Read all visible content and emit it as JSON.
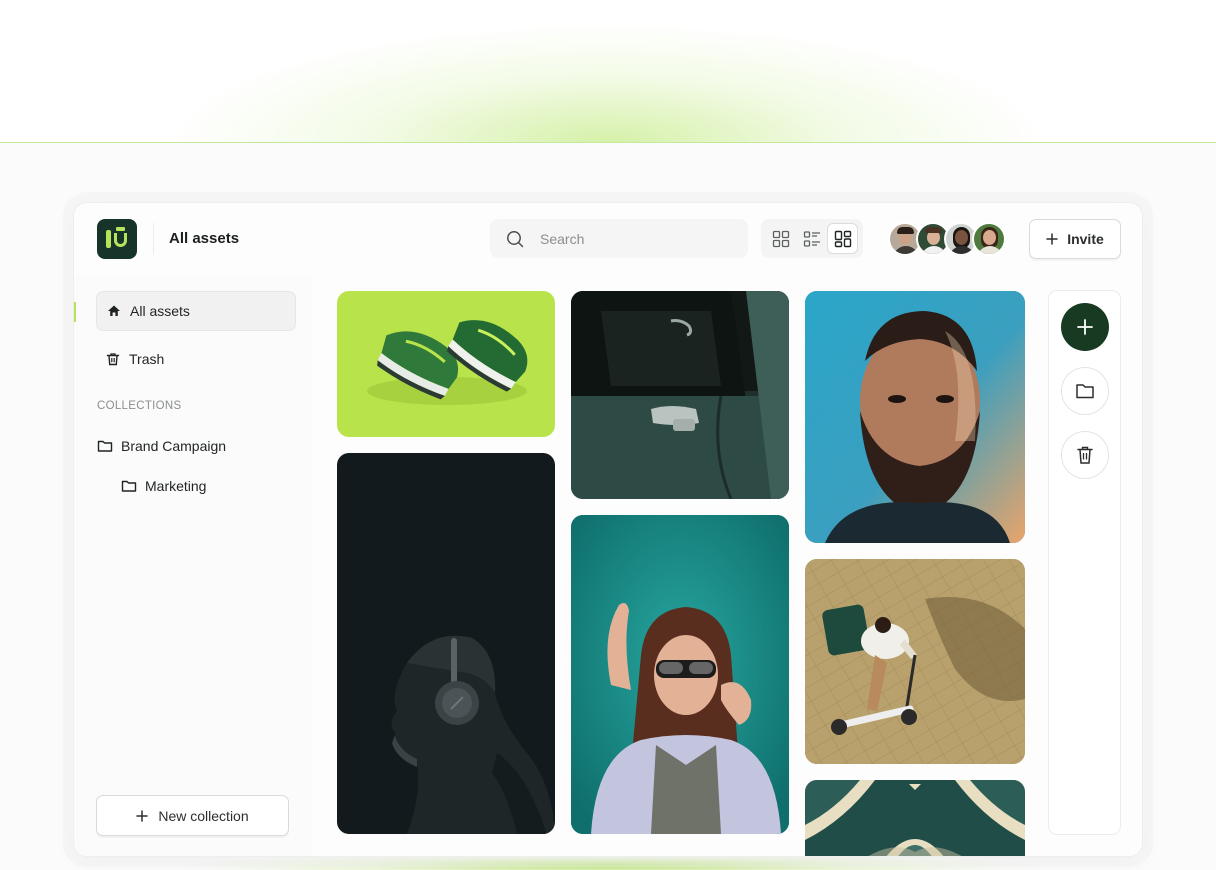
{
  "header": {
    "title": "All assets",
    "search_placeholder": "Search",
    "invite_label": "Invite",
    "view_modes": [
      "grid-view",
      "list-view",
      "masonry-view"
    ],
    "active_view": "masonry-view"
  },
  "collaborators": [
    {
      "icon": "avatar-man-beard"
    },
    {
      "icon": "avatar-man-glasses"
    },
    {
      "icon": "avatar-woman-dark-hair"
    },
    {
      "icon": "avatar-woman-glasses"
    }
  ],
  "sidebar": {
    "items": [
      {
        "label": "All assets",
        "icon": "home-icon",
        "active": true
      },
      {
        "label": "Trash",
        "icon": "trash-icon",
        "active": false
      }
    ],
    "collections_heading": "COLLECTIONS",
    "collections": [
      {
        "label": "Brand Campaign",
        "icon": "folder-icon",
        "level": 0
      },
      {
        "label": "Marketing",
        "icon": "folder-icon",
        "level": 1
      }
    ],
    "new_collection_label": "New collection"
  },
  "gallery": {
    "assets": [
      {
        "subject": "sneakers-on-green"
      },
      {
        "subject": "headphones-portrait"
      },
      {
        "subject": "car-door"
      },
      {
        "subject": "girl-sunglasses"
      },
      {
        "subject": "bearded-man-portrait"
      },
      {
        "subject": "scooter-delivery"
      },
      {
        "subject": "architecture-pattern"
      }
    ]
  },
  "actions": [
    {
      "icon": "plus-icon",
      "style": "primary"
    },
    {
      "icon": "folder-icon",
      "style": "outline"
    },
    {
      "icon": "trash-icon",
      "style": "outline"
    }
  ],
  "colors": {
    "brand_dark": "#17342a",
    "brand_accent": "#b7e35a",
    "primary_action": "#183a22"
  }
}
